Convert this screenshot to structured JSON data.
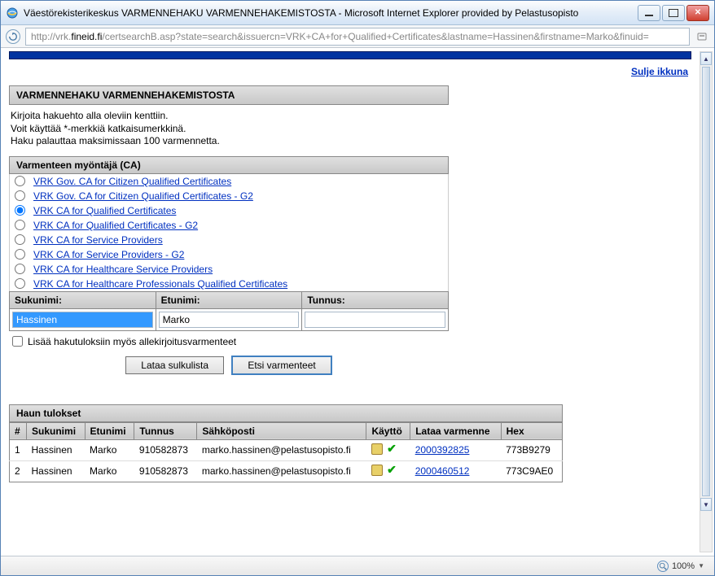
{
  "window": {
    "title": "Väestörekisterikeskus VARMENNEHAKU VARMENNEHAKEMISTOSTA - Microsoft Internet Explorer provided by Pelastusopisto"
  },
  "addressbar": {
    "url_prefix": "http://vrk.",
    "url_host": "fineid.fi",
    "url_path": "/certsearchB.asp?state=search&issuercn=VRK+CA+for+Qualified+Certificates&lastname=Hassinen&firstname=Marko&finuid="
  },
  "page": {
    "close_link": "Sulje ikkuna",
    "main_header": "VARMENNEHAKU VARMENNEHAKEMISTOSTA",
    "intro_line1": "Kirjoita hakuehto alla oleviin kenttiin.",
    "intro_line2": "Voit käyttää *-merkkiä katkaisumerkkinä.",
    "intro_line3": "Haku palauttaa maksimissaan 100 varmennetta.",
    "ca_header": "Varmenteen myöntäjä (CA)",
    "ca_options": [
      {
        "label": "VRK Gov. CA for Citizen Qualified Certificates",
        "checked": false
      },
      {
        "label": "VRK Gov. CA for Citizen Qualified Certificates - G2",
        "checked": false
      },
      {
        "label": "VRK CA for Qualified Certificates",
        "checked": true
      },
      {
        "label": "VRK CA for Qualified Certificates - G2",
        "checked": false
      },
      {
        "label": "VRK CA for Service Providers",
        "checked": false
      },
      {
        "label": "VRK CA for Service Providers - G2",
        "checked": false
      },
      {
        "label": "VRK CA for Healthcare Service Providers",
        "checked": false
      },
      {
        "label": "VRK CA for Healthcare Professionals Qualified Certificates",
        "checked": false
      }
    ],
    "fields": {
      "lastname_label": "Sukunimi:",
      "lastname_value": "Hassinen",
      "firstname_label": "Etunimi:",
      "firstname_value": "Marko",
      "id_label": "Tunnus:",
      "id_value": ""
    },
    "checkbox_label": "Lisää hakutuloksiin myös allekirjoitusvarmenteet",
    "buttons": {
      "crl": "Lataa sulkulista",
      "search": "Etsi varmenteet"
    },
    "results_header": "Haun tulokset",
    "results_columns": {
      "num": "#",
      "lastname": "Sukunimi",
      "firstname": "Etunimi",
      "id": "Tunnus",
      "email": "Sähköposti",
      "usage": "Käyttö",
      "download": "Lataa varmenne",
      "hex": "Hex"
    },
    "results_rows": [
      {
        "num": "1",
        "lastname": "Hassinen",
        "firstname": "Marko",
        "id": "910582873",
        "email": "marko.hassinen@pelastusopisto.fi",
        "download": "2000392825",
        "hex": "773B9279"
      },
      {
        "num": "2",
        "lastname": "Hassinen",
        "firstname": "Marko",
        "id": "910582873",
        "email": "marko.hassinen@pelastusopisto.fi",
        "download": "2000460512",
        "hex": "773C9AE0"
      }
    ]
  },
  "statusbar": {
    "zoom": "100%"
  }
}
